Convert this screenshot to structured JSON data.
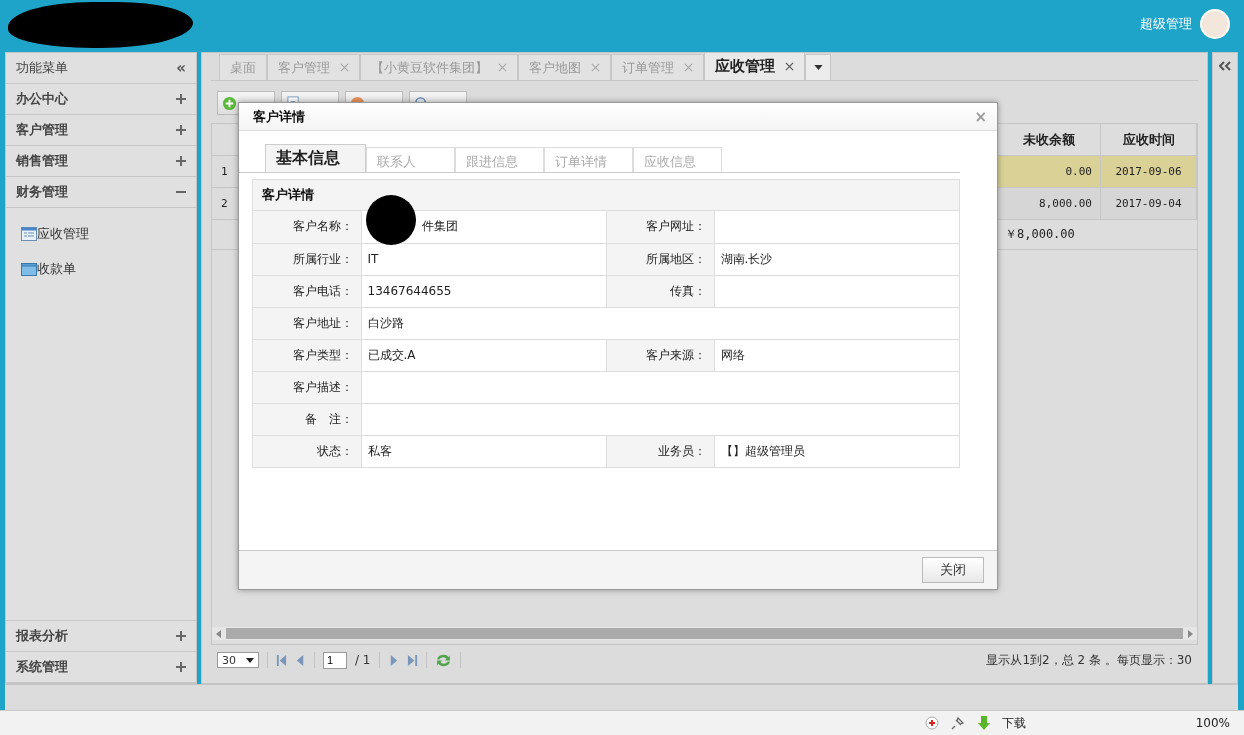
{
  "header": {
    "user": "超级管理"
  },
  "sidebar": {
    "title": "功能菜单",
    "collapse": "«",
    "top_groups": [
      {
        "label": "办公中心",
        "expanded": false
      },
      {
        "label": "客户管理",
        "expanded": false
      },
      {
        "label": "销售管理",
        "expanded": false
      },
      {
        "label": "财务管理",
        "expanded": true,
        "children": [
          {
            "label": "应收管理"
          },
          {
            "label": "收款单"
          }
        ]
      }
    ],
    "bottom_groups": [
      {
        "label": "报表分析",
        "expanded": false
      },
      {
        "label": "系统管理",
        "expanded": false
      }
    ]
  },
  "tabs": [
    {
      "label": "桌面",
      "closable": false,
      "selected": false
    },
    {
      "label": "客户管理",
      "closable": true,
      "selected": false
    },
    {
      "label": "【小黄豆软件集团】",
      "closable": true,
      "selected": false
    },
    {
      "label": "客户地图",
      "closable": true,
      "selected": false
    },
    {
      "label": "订单管理",
      "closable": true,
      "selected": false
    },
    {
      "label": "应收管理",
      "closable": true,
      "selected": true
    }
  ],
  "toolbar": [
    {
      "kind": "add"
    },
    {
      "kind": "edit"
    },
    {
      "kind": "delete"
    },
    {
      "kind": "search"
    }
  ],
  "grid": {
    "columns": [
      "未收余额",
      "应收时间"
    ],
    "rows": [
      {
        "number": "1",
        "balance": "0.00",
        "due": "2017-09-06",
        "selected": true
      },
      {
        "number": "2",
        "balance": "8,000.00",
        "due": "2017-09-04",
        "selected": false
      }
    ],
    "total": "￥8,000.00"
  },
  "pager": {
    "page_size": "30",
    "page": "1",
    "pages": "/ 1",
    "summary": "显示从1到2，总 2 条 。每页显示：30"
  },
  "dialog": {
    "title": "客户详情",
    "close": "×",
    "tabs": [
      {
        "label": "基本信息",
        "selected": true
      },
      {
        "label": "联系人",
        "selected": false
      },
      {
        "label": "跟进信息",
        "selected": false
      },
      {
        "label": "订单详情",
        "selected": false
      },
      {
        "label": "应收信息",
        "selected": false
      }
    ],
    "section": "客户详情",
    "rows": [
      [
        {
          "label": "客户名称：",
          "value": "件集团",
          "redacted": true
        },
        {
          "label": "客户网址："
        }
      ],
      [
        {
          "label": "所属行业：",
          "value": "IT"
        },
        {
          "label": "所属地区：",
          "value": "湖南.长沙"
        }
      ],
      [
        {
          "label": "客户电话：",
          "value": "13467644655"
        },
        {
          "label": "传真："
        }
      ],
      [
        {
          "label": "客户地址：",
          "value": "白沙路"
        }
      ],
      [
        {
          "label": "客户类型：",
          "value": "已成交.A"
        },
        {
          "label": "客户来源：",
          "value": "网络"
        }
      ],
      [
        {
          "label": "客户描述："
        }
      ],
      [
        {
          "label": "备　注："
        }
      ],
      [
        {
          "label": "状态：",
          "value": "私客"
        },
        {
          "label": "业务员：",
          "value": "【】超级管理员"
        }
      ]
    ],
    "button": "关闭"
  },
  "statusbar": {
    "download": "下载",
    "zoom": "100%"
  }
}
